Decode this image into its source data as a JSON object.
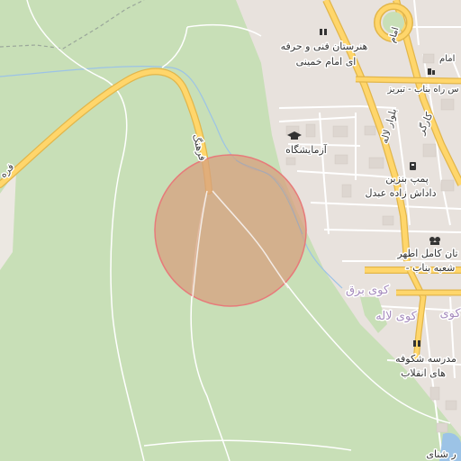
{
  "map": {
    "colors": {
      "park": "#c8dfb7",
      "urban": "#e8e2dd",
      "major_road": "#ffd66b",
      "major_road_casing": "#e2b64a",
      "minor_road": "#ffffff",
      "water": "#9cc3e6",
      "circle_fill": "#d7a07f",
      "circle_stroke": "#e77a7a"
    },
    "labels": {
      "poi_school_1_line1": "هنرستان فنی و حرفه",
      "poi_school_1_line2": "ای امام خمینی",
      "poi_lab": "آزمایشگاه",
      "poi_gas_line1": "پمپ بنزین",
      "poi_gas_line2": "داداش زاده عبدل",
      "poi_bank_line1": "تان کامل اطهر",
      "poi_bank_line2": "- شعبه بناب",
      "poi_school_2_line1": "مدرسه شکوفه",
      "poi_school_2_line2": "های انقلاب",
      "poi_top_right_1": "امام",
      "poi_top_right_2": "س راه بناب - تبریز",
      "road_top_curve": "فرهنگ",
      "road_lale_blvd": "بلوار لاله",
      "road_kargar": "کارگر",
      "road_left_edge": "فره",
      "district_barq": "کوی برق",
      "district_lale": "کوی لاله",
      "district_lale_2": "کوی",
      "bottom_right": "ر شنای",
      "top_right_corner": "امام"
    }
  }
}
